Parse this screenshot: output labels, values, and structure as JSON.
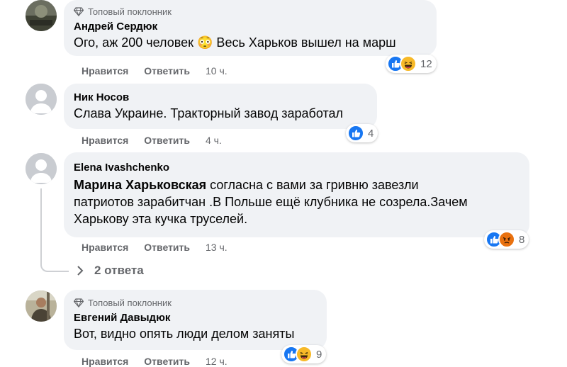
{
  "comments": [
    {
      "badge": "Топовый поклонник",
      "name": "Андрей Сердюк",
      "text": "Ого, аж 200 человек 😳 Весь Харьков вышел на марш",
      "like_label": "Нравится",
      "reply_label": "Ответить",
      "time": "10 ч.",
      "reactions": [
        "like",
        "haha"
      ],
      "reaction_count": "12"
    },
    {
      "name": "Ник Носов",
      "text": "Слава Украине. Тракторный завод заработал",
      "like_label": "Нравится",
      "reply_label": "Ответить",
      "time": "4 ч.",
      "reactions": [
        "like"
      ],
      "reaction_count": "4"
    },
    {
      "name": "Elena Ivashchenko",
      "mention": "Марина Харьковская",
      "text_line1": " согласна с вами за гривню завезли",
      "text_line2": "патриотов зарабитчан .В Польше ещё клубника не созрела.Зачем",
      "text_line3": "Харькову эта кучка труселей.",
      "like_label": "Нравится",
      "reply_label": "Ответить",
      "time": "13 ч.",
      "reactions": [
        "like",
        "angry"
      ],
      "reaction_count": "8",
      "replies_label": "2 ответа"
    },
    {
      "badge": "Топовый поклонник",
      "name": "Евгений Давыдюк",
      "text": "Вот, видно опять люди делом заняты",
      "like_label": "Нравится",
      "reply_label": "Ответить",
      "time": "12 ч.",
      "reactions": [
        "like",
        "haha"
      ],
      "reaction_count": "9"
    }
  ],
  "colors": {
    "bubble": "#f0f2f5",
    "meta": "#65676b",
    "like": "#1877f2",
    "haha": "#f7b928",
    "angry": "#e9710f"
  },
  "icons": {
    "badge": "diamond-icon",
    "like": "thumbs-up-icon",
    "haha": "laughing-face-icon",
    "angry": "angry-face-icon",
    "reply_arrow": "reply-arrow-icon"
  }
}
